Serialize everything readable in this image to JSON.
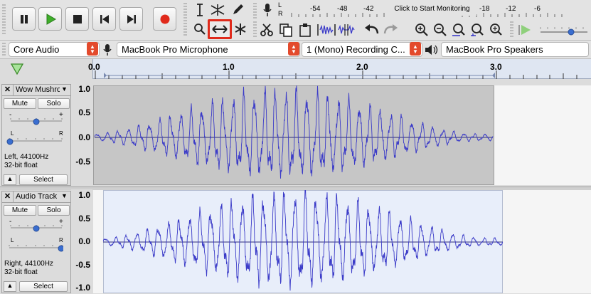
{
  "meter": {
    "record_ticks": [
      "-54",
      "-48",
      "-42",
      "-18",
      "-12",
      "-6"
    ],
    "monitor_label": "Click to Start Monitoring",
    "channel_left": "L",
    "channel_right": "R"
  },
  "devices": {
    "host": "Core Audio",
    "recording_device": "MacBook Pro Microphone",
    "channels": "1 (Mono) Recording C...",
    "playback_device": "MacBook Pro Speakers"
  },
  "timeline": {
    "ticks": [
      "0.0",
      "1.0",
      "2.0",
      "3.0"
    ]
  },
  "tracks": [
    {
      "name": "Wow Mushro",
      "mute": "Mute",
      "solo": "Solo",
      "gain_minus": "-",
      "gain_plus": "+",
      "pan_left": "L",
      "pan_right": "R",
      "info_line1": "Left, 44100Hz",
      "info_line2": "32-bit float",
      "select": "Select",
      "scale": [
        "1.0",
        "0.5",
        "0.0",
        "-0.5"
      ],
      "selected": true
    },
    {
      "name": "Audio Track",
      "mute": "Mute",
      "solo": "Solo",
      "gain_minus": "-",
      "gain_plus": "+",
      "pan_left": "L",
      "pan_right": "R",
      "info_line1": "Right, 44100Hz",
      "info_line2": "32-bit float",
      "select": "Select",
      "scale": [
        "1.0",
        "0.5",
        "0.0",
        "-0.5",
        "-1.0"
      ],
      "selected": false
    }
  ],
  "colors": {
    "waveform": "#3b3bc8",
    "highlight": "#e02a1b",
    "play_green": "#3fae2a",
    "record_red": "#e02a1b"
  }
}
